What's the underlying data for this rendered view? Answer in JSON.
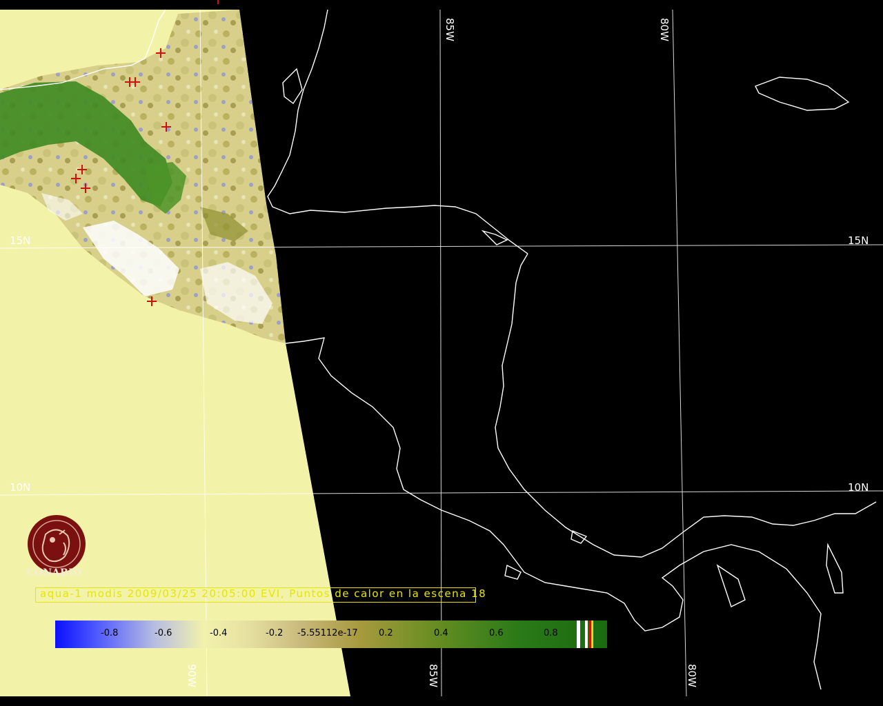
{
  "grid_labels": {
    "lon_85w_top": "85W",
    "lon_80w_top": "80W",
    "lat_15n_left": "15N",
    "lat_15n_right": "15N",
    "lat_10n_left": "10N",
    "lat_10n_right": "10N",
    "lon_90w_bottom": "90W",
    "lon_85w_bottom": "85W",
    "lon_80w_bottom": "80W"
  },
  "logo": {
    "text": "CONABIO"
  },
  "caption": "aqua-1 modis 2009/03/25 20:05:00 EVI, Puntos de calor en la escena  18",
  "colorbar": {
    "ticks": [
      "-0.8",
      "-0.6",
      "-0.4",
      "-0.2",
      "-5.55112e-17",
      "0.2",
      "0.4",
      "0.6",
      "0.8"
    ]
  },
  "colors": {
    "background": "#000000",
    "no_data_fill": "#f2f2a8",
    "coastline": "#ffffff",
    "caption": "#e6e600",
    "hotspot": "#cc1111"
  }
}
